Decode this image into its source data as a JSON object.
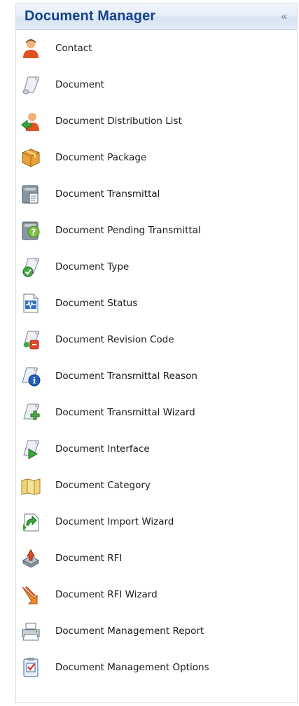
{
  "panel": {
    "title": "Document Manager",
    "collapse_glyph": "«",
    "title_color": "#15428b"
  },
  "items": [
    {
      "label": "Contact",
      "icon": "contact-icon"
    },
    {
      "label": "Document",
      "icon": "document-scroll-icon"
    },
    {
      "label": "Document Distribution List",
      "icon": "distribution-list-icon"
    },
    {
      "label": "Document Package",
      "icon": "package-icon"
    },
    {
      "label": "Document Transmittal",
      "icon": "transmittal-icon"
    },
    {
      "label": "Document Pending Transmittal",
      "icon": "pending-transmittal-icon"
    },
    {
      "label": "Document Type",
      "icon": "document-type-icon"
    },
    {
      "label": "Document Status",
      "icon": "document-status-icon"
    },
    {
      "label": "Document Revision Code",
      "icon": "revision-code-icon"
    },
    {
      "label": "Document Transmittal Reason",
      "icon": "transmittal-reason-icon"
    },
    {
      "label": "Document Transmittal Wizard",
      "icon": "transmittal-wizard-icon"
    },
    {
      "label": "Document Interface",
      "icon": "document-interface-icon"
    },
    {
      "label": "Document Category",
      "icon": "category-icon"
    },
    {
      "label": "Document Import Wizard",
      "icon": "import-wizard-icon"
    },
    {
      "label": "Document RFI",
      "icon": "rfi-icon"
    },
    {
      "label": "Document RFI Wizard",
      "icon": "rfi-wizard-icon"
    },
    {
      "label": "Document Management Report",
      "icon": "printer-icon"
    },
    {
      "label": "Document Management Options",
      "icon": "options-checklist-icon"
    }
  ]
}
